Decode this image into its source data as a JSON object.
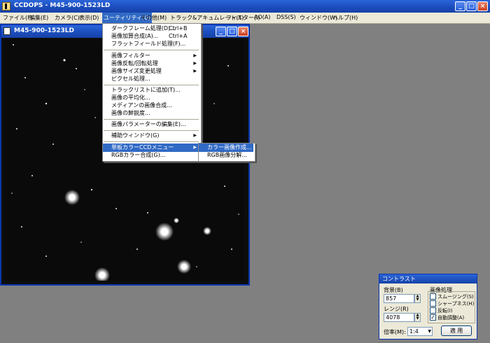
{
  "app": {
    "title": "CCDOPS - M45-900-1523LD"
  },
  "caption_buttons": {
    "minimize": "_",
    "maximize": "□",
    "close": "×"
  },
  "menubar": {
    "items": [
      "ファイル(F)",
      "編集(E)",
      "カメラ(C)",
      "表示(D)",
      "ユーティリティ(U)",
      "その他(M)",
      "トラック&アキュムレート(T)",
      "フィルター(I)",
      "AO(A)",
      "DSS(S)",
      "ウィンドウ(W)",
      "ヘルプ(H)"
    ],
    "active_index": 4
  },
  "image_window": {
    "title": "M45-900-1523LD"
  },
  "utility_menu": {
    "items": [
      {
        "label": "ダークフレーム処理(D)...",
        "shortcut": "Ctrl+B"
      },
      {
        "label": "画像加算合成(A)...",
        "shortcut": "Ctrl+A"
      },
      {
        "label": "フラットフィールド処理(F)...",
        "shortcut": ""
      },
      {
        "label": "画像フィルター",
        "submenu": true
      },
      {
        "label": "画像反転/回転処理",
        "submenu": true
      },
      {
        "label": "画像サイズ変更処理",
        "submenu": true
      },
      {
        "label": "ピクセル処理...",
        "shortcut": ""
      },
      {
        "label": "トラックリストに追加(T)...",
        "shortcut": ""
      },
      {
        "label": "画像の平均化...",
        "shortcut": ""
      },
      {
        "label": "メディアンの画像合成...",
        "shortcut": ""
      },
      {
        "label": "画像の鮮鋭度...",
        "shortcut": ""
      },
      {
        "label": "画像パラメーターの編集(E)...",
        "shortcut": ""
      },
      {
        "label": "補助ウィンドウ(G)",
        "submenu": true
      },
      {
        "label": "単板カラーCCDメニュー",
        "submenu": true,
        "highlighted": true
      },
      {
        "label": "RGBカラー合成(G)...",
        "shortcut": ""
      }
    ],
    "arrow": "▶"
  },
  "color_submenu": {
    "items": [
      "カラー画像作成...",
      "RGB画像分解..."
    ],
    "highlighted_index": 0
  },
  "contrast_panel": {
    "title": "コントラスト",
    "background_label": "背景(B)",
    "background_value": "857",
    "range_label": "レンジ(R)",
    "range_value": "4078",
    "processing_label": "画像処理",
    "options": [
      {
        "label": "スムージング(S)",
        "checked": false
      },
      {
        "label": "シャープネス(H)",
        "checked": false
      },
      {
        "label": "反転(I)",
        "checked": false
      },
      {
        "label": "自動調整(A)",
        "checked": true
      }
    ],
    "zoom_label": "倍率(M):",
    "zoom_value": "1:4",
    "apply_label": "適 用",
    "check_mark": "✓",
    "dropdown_arrow": "▼",
    "spin_up": "▲",
    "spin_down": "▼"
  },
  "colors": {
    "titlebar": "#1d4fbf",
    "desktop": "#808080",
    "menu_highlight": "#316ac5"
  }
}
